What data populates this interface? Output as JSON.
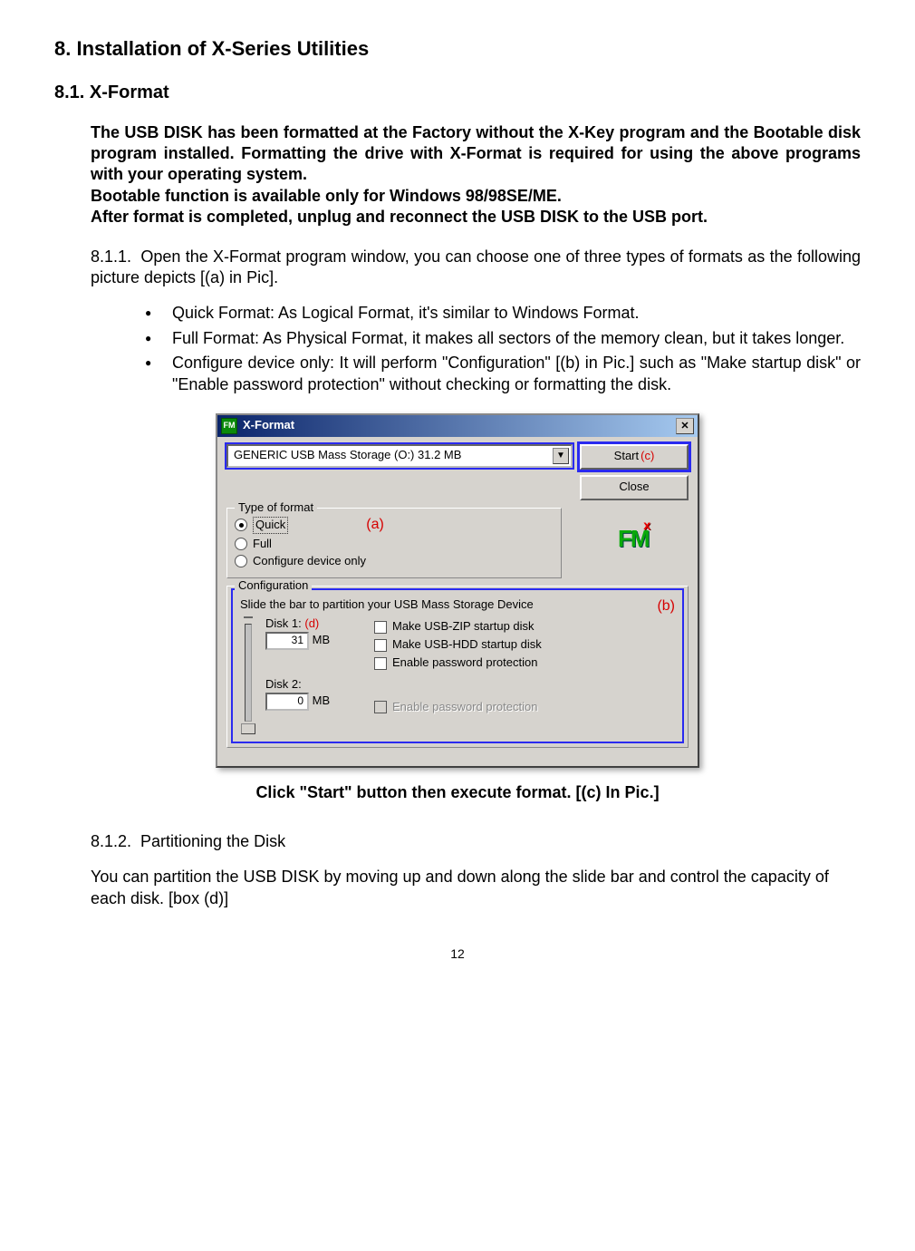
{
  "heading_main": "8.  Installation of X-Series Utilities",
  "heading_sub": "8.1.  X-Format",
  "intro_bold": "The USB DISK has been formatted at the Factory without the X-Key program and the Bootable disk program installed. Formatting the drive with X-Format is required for using the above programs with your operating system.\nBootable function is available only for Windows 98/98SE/ME.\nAfter format is completed, unplug and reconnect the USB DISK to the USB port.",
  "s_811_num": "8.1.1.",
  "s_811_text": "Open the X-Format program window, you can choose one of three types of formats as the following picture depicts [(a) in Pic].",
  "bullets": {
    "b1": "Quick Format: As Logical Format, it's similar to Windows Format.",
    "b2": "Full Format: As Physical Format, it makes all sectors of the memory clean, but it takes longer.",
    "b3": "Configure device only: It will perform \"Configuration\" [(b) in Pic.] such as \"Make startup disk\" or \"Enable password protection\" without checking or formatting the disk."
  },
  "caption": "Click \"Start\" button then execute format. [(c) In Pic.]",
  "s_812_num": "8.1.2.",
  "s_812_title": "Partitioning the Disk",
  "s_812_text": "You can partition the USB DISK by moving up and down along the slide bar and control the capacity of each disk. [box (d)]",
  "page_number": "12",
  "dialog": {
    "icon": "FM",
    "title": "X-Format",
    "combo_text": "GENERIC USB Mass Storage (O:)  31.2 MB",
    "start_label": "Start",
    "start_marker": "(c)",
    "close_label": "Close",
    "type_legend": "Type of format",
    "radio_quick": "Quick",
    "radio_full": "Full",
    "radio_cfg": "Configure device only",
    "marker_a": "(a)",
    "fm_big": "FM",
    "fm_x": "x",
    "config_legend": "Configuration",
    "slide_text": "Slide the bar to partition your USB Mass Storage Device",
    "marker_b": "(b)",
    "disk1_label": "Disk 1:",
    "marker_d": "(d)",
    "disk1_val": "31",
    "mb": "MB",
    "disk2_label": "Disk 2:",
    "disk2_val": "0",
    "chk_zip": "Make USB-ZIP startup disk",
    "chk_hdd": "Make USB-HDD startup disk",
    "chk_pw1": "Enable password protection",
    "chk_pw2": "Enable password protection"
  }
}
